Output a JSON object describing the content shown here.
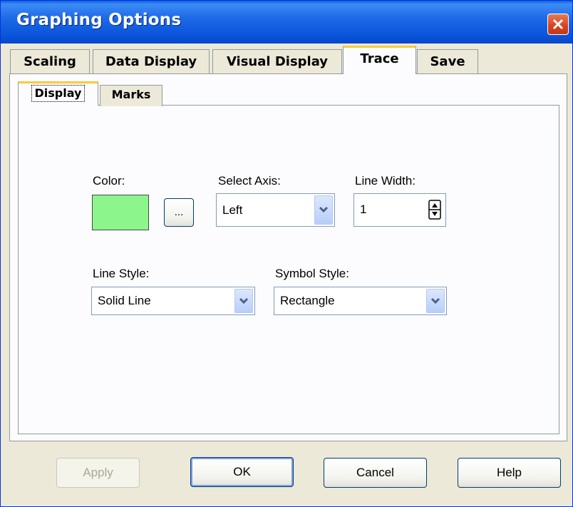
{
  "window": {
    "title": "Graphing Options"
  },
  "tabs": [
    {
      "label": "Scaling"
    },
    {
      "label": "Data Display"
    },
    {
      "label": "Visual Display"
    },
    {
      "label": "Trace"
    },
    {
      "label": "Save"
    }
  ],
  "subtabs": [
    {
      "label": "Display"
    },
    {
      "label": "Marks"
    }
  ],
  "display": {
    "color_label": "Color:",
    "color_value": "#8CF58C",
    "browse_label": "...",
    "axis_label": "Select Axis:",
    "axis_value": "Left",
    "width_label": "Line Width:",
    "width_value": "1",
    "line_style_label": "Line Style:",
    "line_style_value": "Solid Line",
    "symbol_label": "Symbol Style:",
    "symbol_value": "Rectangle"
  },
  "buttons": {
    "apply": "Apply",
    "ok": "OK",
    "cancel": "Cancel",
    "help": "Help"
  }
}
